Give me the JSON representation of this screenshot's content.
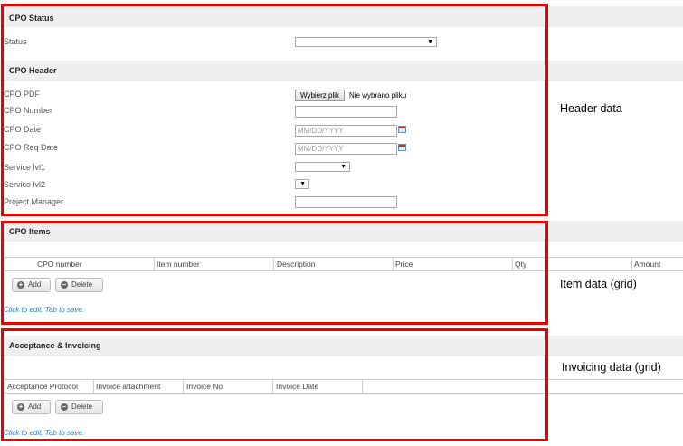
{
  "status_section": {
    "title": "CPO Status",
    "status_label": "Status",
    "status_value": ""
  },
  "header_section": {
    "title": "CPO Header",
    "pdf_label": "CPO PDF",
    "file_button": "Wybierz plik",
    "file_status": "Nie wybrano pliku",
    "number_label": "CPO Number",
    "date_label": "CPO Date",
    "date_placeholder": "MM/DD/YYYY",
    "req_date_label": "CPO Req Date",
    "req_date_placeholder": "MM/DD/YYYY",
    "service1_label": "Service lvl1",
    "service2_label": "Service lvl2",
    "pm_label": "Project Manager"
  },
  "items_section": {
    "title": "CPO Items",
    "columns": [
      "CPO number",
      "Item number",
      "Description",
      "Price",
      "Qty",
      "Amount"
    ],
    "add_label": "Add",
    "delete_label": "Delete",
    "hint": "Click to edit. Tab to save."
  },
  "invoicing_section": {
    "title": "Acceptance & Invoicing",
    "columns": [
      "Acceptance Protocol",
      "Invoice attachment",
      "Invoice No",
      "Invoice Date"
    ],
    "add_label": "Add",
    "delete_label": "Delete",
    "hint": "Click to edit. Tab to save."
  },
  "annotations": {
    "header": "Header data",
    "items": "Item data (grid)",
    "invoicing": "Invoicing data (grid)"
  },
  "colors": {
    "frame": "#ee0000",
    "band": "#efefef",
    "hint": "#2a7bbf"
  },
  "icons": [
    "dropdown-arrow-icon",
    "calendar-icon",
    "add-circle-icon",
    "delete-circle-icon"
  ]
}
